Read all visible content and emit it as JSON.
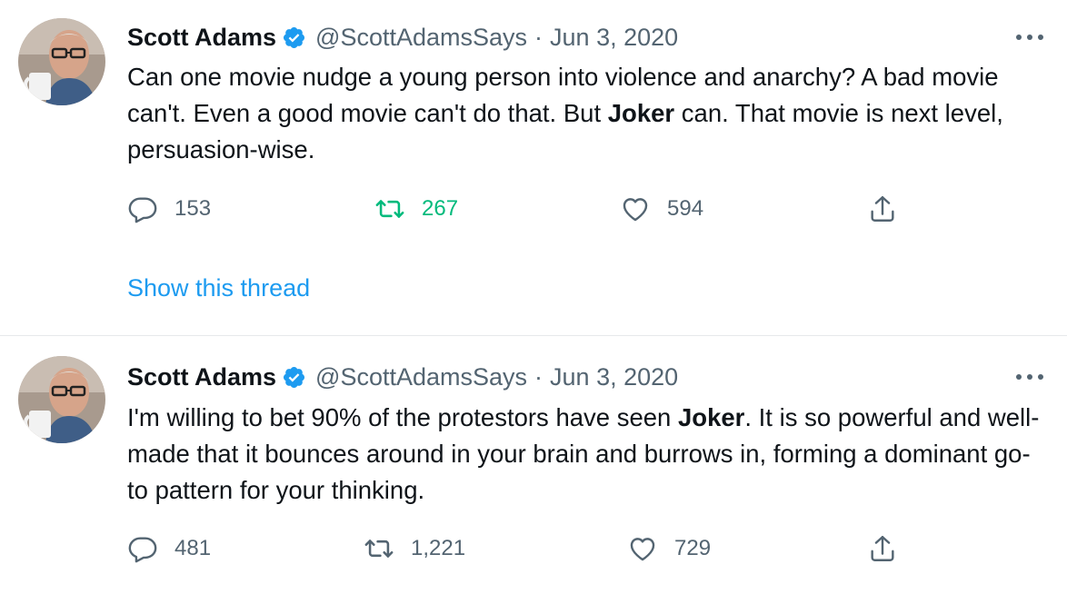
{
  "tweets": [
    {
      "author": {
        "name": "Scott Adams",
        "handle": "@ScottAdamsSays",
        "verified": true
      },
      "separator": "·",
      "date": "Jun 3, 2020",
      "text": {
        "part1": "Can one movie nudge a young person into violence and anarchy? A bad movie can't. Even a good movie can't do that. But ",
        "bold": "Joker",
        "part2": " can. That movie is next level, persuasion-wise."
      },
      "stats": {
        "replies": "153",
        "retweets": "267",
        "likes": "594"
      },
      "retweeted": true,
      "show_thread_label": "Show this thread"
    },
    {
      "author": {
        "name": "Scott Adams",
        "handle": "@ScottAdamsSays",
        "verified": true
      },
      "separator": "·",
      "date": "Jun 3, 2020",
      "text": {
        "part1": "I'm willing to bet 90% of the protestors have seen ",
        "bold": "Joker",
        "part2": ". It is so powerful and well-made that it bounces around in your brain and burrows in, forming a dominant go-to pattern for your thinking."
      },
      "stats": {
        "replies": "481",
        "retweets": "1,221",
        "likes": "729"
      },
      "retweeted": false
    }
  ],
  "colors": {
    "text": "#0f1419",
    "secondary": "#536471",
    "accent_blue": "#1d9bf0",
    "retweet_green": "#00ba7c",
    "divider": "#e6e9eb"
  },
  "icons": [
    "avatar-photo",
    "verified-badge-icon",
    "more-options-icon",
    "reply-icon",
    "retweet-icon",
    "like-icon",
    "share-icon"
  ]
}
